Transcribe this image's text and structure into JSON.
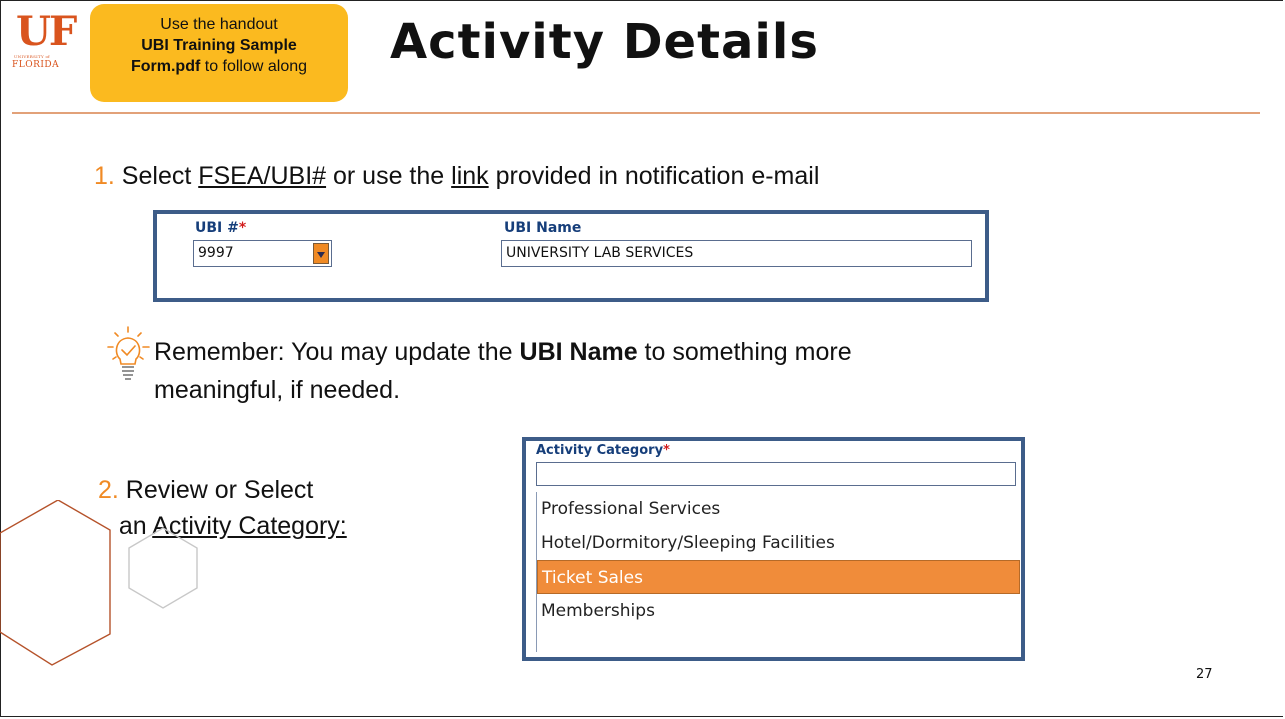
{
  "logo": {
    "mark": "UF",
    "university_of": "UNIVERSITY of",
    "florida": "FLORIDA"
  },
  "handout": {
    "line1": "Use the handout",
    "bold1": "UBI Training Sample",
    "bold2": "Form.pdf",
    "line3_rest": " to follow along"
  },
  "title": "Activity Details",
  "step1": {
    "number": "1.",
    "pre": " Select ",
    "link1": "FSEA/UBI#",
    "mid": " or use the ",
    "link2": "link",
    "post": " provided in notification e-mail"
  },
  "ubi_form": {
    "ubi_label": "UBI #",
    "required_mark": "*",
    "ubi_value": "9997",
    "name_label": "UBI Name",
    "name_value": "UNIVERSITY LAB SERVICES"
  },
  "remember": {
    "icon": "lightbulb-check-icon",
    "pre": "Remember:  You may update the ",
    "bold": "UBI Name",
    "post": " to something more meaningful, if needed."
  },
  "step2": {
    "number": "2.",
    "line1": " Review or Select",
    "line2_pre": " an ",
    "link": "Activity Category:"
  },
  "activity": {
    "label": "Activity Category",
    "required_mark": "*",
    "input_value": "",
    "options": [
      {
        "label": "Professional Services",
        "selected": false
      },
      {
        "label": "Hotel/Dormitory/Sleeping Facilities",
        "selected": false
      },
      {
        "label": "Ticket Sales",
        "selected": true
      },
      {
        "label": "Memberships",
        "selected": false
      }
    ]
  },
  "page_number": "27",
  "colors": {
    "accent_orange": "#f08a24",
    "handout_yellow": "#fbba1f",
    "panel_blue": "#3d5c88",
    "label_blue": "#163e7a",
    "selected_orange": "#f08c3a",
    "hex_brown": "#b5522a"
  }
}
